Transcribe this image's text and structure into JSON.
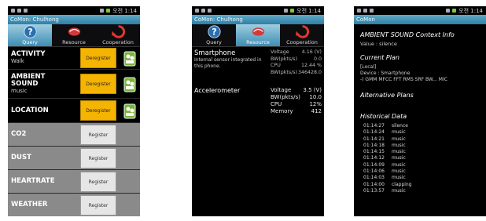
{
  "status": {
    "time": "오전 1:14"
  },
  "phone1": {
    "title": "CoMon: Chulhong",
    "tabs": [
      {
        "label": "Query",
        "icon": "question-icon"
      },
      {
        "label": "Resource",
        "icon": "sensor-icon"
      },
      {
        "label": "Cooperation",
        "icon": "sync-icon"
      }
    ],
    "active_rows": [
      {
        "name": "ACTIVITY",
        "sub": "Walk",
        "button": "Deregister"
      },
      {
        "name": "AMBIENT SOUND",
        "sub": "music",
        "button": "Deregister"
      },
      {
        "name": "LOCATION",
        "sub": "",
        "button": "Deregister"
      }
    ],
    "inactive_rows": [
      {
        "name": "CO2",
        "button": "Register"
      },
      {
        "name": "DUST",
        "button": "Register"
      },
      {
        "name": "HEARTRATE",
        "button": "Register"
      },
      {
        "name": "WEATHER",
        "button": "Register"
      }
    ]
  },
  "phone2": {
    "title": "CoMon: Chulhong",
    "tabs": [
      {
        "label": "Query",
        "icon": "question-icon"
      },
      {
        "label": "Resource",
        "icon": "sensor-icon"
      },
      {
        "label": "Cooperation",
        "icon": "sync-icon"
      }
    ],
    "smartphone": {
      "name": "Smartphone",
      "desc": "Internal sensor integrated in this phone.",
      "voltage_label": "Voltage",
      "voltage_value": "4.16 (V)",
      "bw_label": "BW(pkts/s)",
      "bw_value": "0.0",
      "cpu_label": "CPU",
      "cpu_value": "12.44 %",
      "bwps_label": "BW(pkts/s)",
      "bwps_value": "346428.0"
    },
    "accelerometer": {
      "name": "Accelerometer",
      "voltage_label": "Voltage",
      "voltage_value": "3.5 (V)",
      "bw_label": "BW(pkts/s)",
      "bw_value": "10.0",
      "cpu_label": "CPU",
      "cpu_value": "12%",
      "mem_label": "Memory",
      "mem_value": "412"
    }
  },
  "phone3": {
    "title": "CoMon",
    "heading": "AMBIENT SOUND Context Info",
    "value_line": "Value : silence",
    "current_plan_title": "Current Plan",
    "plan_local": "[Local]",
    "plan_device": "Device : Smartphone",
    "plan_pipeline": "-) GMM MFCC FFT RMS SRF BW... MIC",
    "alt_title": "Alternative Plans",
    "hist_title": "Historical Data",
    "history": [
      {
        "t": "01:14:27",
        "v": "silence"
      },
      {
        "t": "01:14:24",
        "v": "music"
      },
      {
        "t": "01:14:21",
        "v": "music"
      },
      {
        "t": "01:14:18",
        "v": "music"
      },
      {
        "t": "01:14:15",
        "v": "music"
      },
      {
        "t": "01:14:12",
        "v": "music"
      },
      {
        "t": "01:14:09",
        "v": "music"
      },
      {
        "t": "01:14:06",
        "v": "music"
      },
      {
        "t": "01:14:03",
        "v": "music"
      },
      {
        "t": "01:14:00",
        "v": "clapping"
      },
      {
        "t": "01:13:57",
        "v": "music"
      }
    ]
  }
}
